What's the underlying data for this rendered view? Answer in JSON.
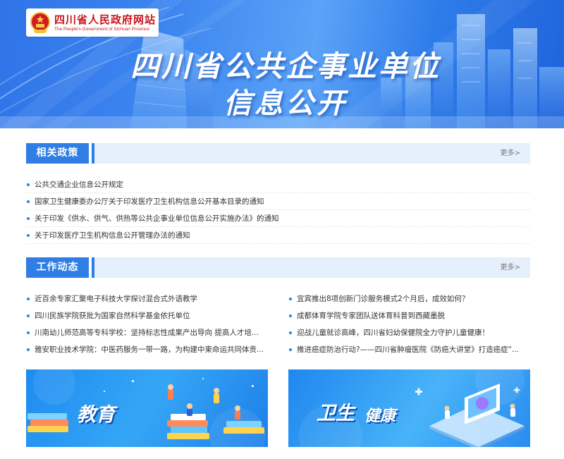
{
  "header": {
    "logo_title": "四川省人民政府网站",
    "logo_subtitle": "The People's Government of Sichuan Province",
    "banner_title_line1": "四川省公共企事业单位",
    "banner_title_line2": "信息公开"
  },
  "policy": {
    "title": "相关政策",
    "more": "更多>",
    "items": [
      "公共交通企业信息公开规定",
      "国家卫生健康委办公厅关于印发医疗卫生机构信息公开基本目录的通知",
      "关于印发《供水、供气、供热等公共企事业单位信息公开实施办法》的通知",
      "关于印发医疗卫生机构信息公开管理办法的通知"
    ]
  },
  "news": {
    "title": "工作动态",
    "more": "更多>",
    "left_items": [
      "近百余专家汇聚电子科技大学探讨混合式外语教学",
      "四川民族学院获批为国家自然科学基金依托单位",
      "川南幼儿师范高等专科学校：坚持标志性成果产出导向 提高人才培...",
      "雅安职业技术学院：中医药服务一带一路，为构建中柬命运共同体贡..."
    ],
    "right_items": [
      "宜宾推出8项创新门诊服务模式2个月后，成效如何？",
      "成都体育学院专家团队送体育科普到西藏墨脱",
      "迎战儿童就诊高峰，四川省妇幼保健院全力守护儿童健康！",
      "推进癌症防治行动?——四川省肿瘤医院《防癌大讲堂》打造癌症“..."
    ]
  },
  "cards": {
    "education": "教育",
    "health_part1": "卫生",
    "health_part2": "健康"
  },
  "colors": {
    "accent": "#2f7ee6",
    "section_bg": "#e5f0fc",
    "logo_red": "#c8161d"
  }
}
